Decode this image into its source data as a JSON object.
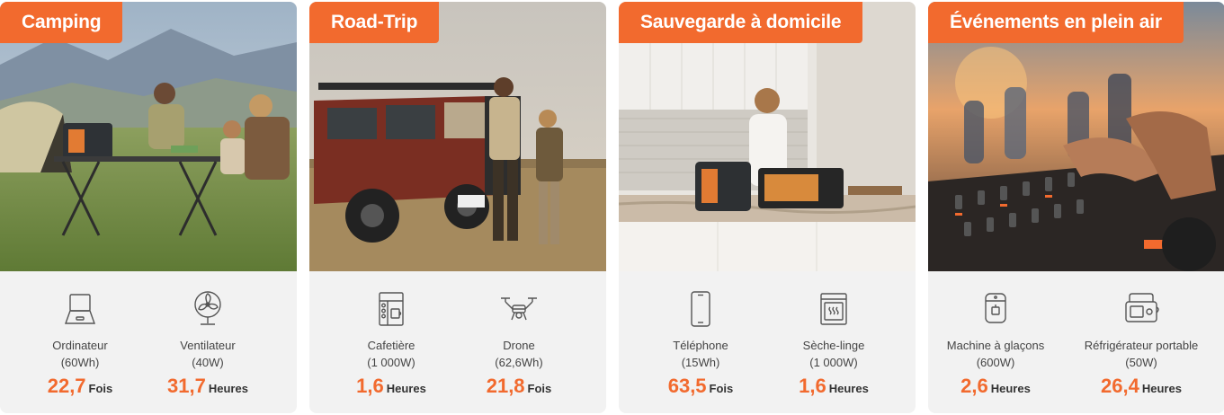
{
  "colors": {
    "accent": "#f26a2e",
    "card_bg": "#f2f2f2",
    "text": "#444444"
  },
  "cards": [
    {
      "title": "Camping",
      "stats": [
        {
          "icon": "laptop-icon",
          "name": "Ordinateur",
          "power": "(60Wh)",
          "value": "22,7",
          "unit": "Fois"
        },
        {
          "icon": "fan-icon",
          "name": "Ventilateur",
          "power": "(40W)",
          "value": "31,7",
          "unit": "Heures"
        }
      ]
    },
    {
      "title": "Road-Trip",
      "stats": [
        {
          "icon": "coffee-maker-icon",
          "name": "Cafetière",
          "power": "(1 000W)",
          "value": "1,6",
          "unit": "Heures"
        },
        {
          "icon": "drone-icon",
          "name": "Drone",
          "power": "(62,6Wh)",
          "value": "21,8",
          "unit": "Fois"
        }
      ]
    },
    {
      "title": "Sauvegarde à domicile",
      "stats": [
        {
          "icon": "phone-icon",
          "name": "Téléphone",
          "power": "(15Wh)",
          "value": "63,5",
          "unit": "Fois"
        },
        {
          "icon": "dryer-icon",
          "name": "Sèche-linge",
          "power": "(1 000W)",
          "value": "1,6",
          "unit": "Heures"
        }
      ]
    },
    {
      "title": "Événements en plein air",
      "stats": [
        {
          "icon": "ice-machine-icon",
          "name": "Machine à glaçons",
          "power": "(600W)",
          "value": "2,6",
          "unit": "Heures"
        },
        {
          "icon": "portable-fridge-icon",
          "name": "Réfrigérateur portable",
          "power": "(50W)",
          "value": "26,4",
          "unit": "Heures"
        }
      ]
    }
  ]
}
